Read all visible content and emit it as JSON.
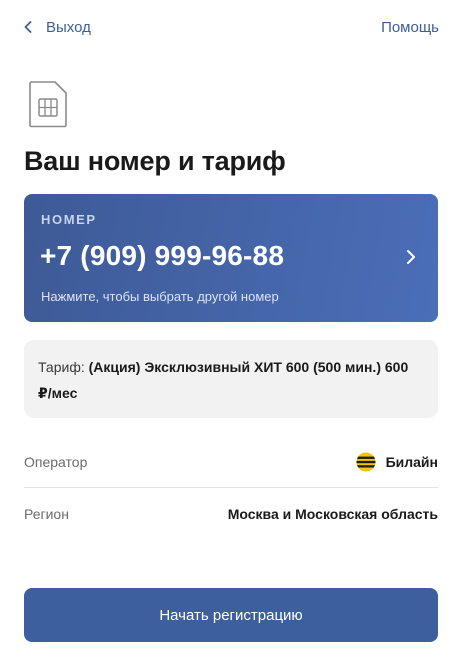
{
  "header": {
    "back_label": "Выход",
    "help_label": "Помощь"
  },
  "title": "Ваш номер и тариф",
  "number_card": {
    "label": "НОМЕР",
    "phone": "+7 (909) 999-96-88",
    "hint": "Нажмите, чтобы выбрать другой номер"
  },
  "tariff": {
    "prefix": "Тариф:",
    "name": "(Акция) Эксклюзивный ХИТ 600 (500 мин.) 600 ₽/мес"
  },
  "details": {
    "operator_label": "Оператор",
    "operator_value": "Билайн",
    "region_label": "Регион",
    "region_value": "Москва и Московская область"
  },
  "actions": {
    "start_label": "Начать регистрацию"
  },
  "colors": {
    "accent": "#3d5e9a",
    "card_gradient_start": "#3e5a96",
    "card_gradient_end": "#4a6eb8",
    "beeline_yellow": "#f5c400"
  },
  "icons": {
    "back": "chevron-left-icon",
    "sim": "sim-card-icon",
    "card_arrow": "chevron-right-icon",
    "operator": "beeline-logo-icon"
  }
}
